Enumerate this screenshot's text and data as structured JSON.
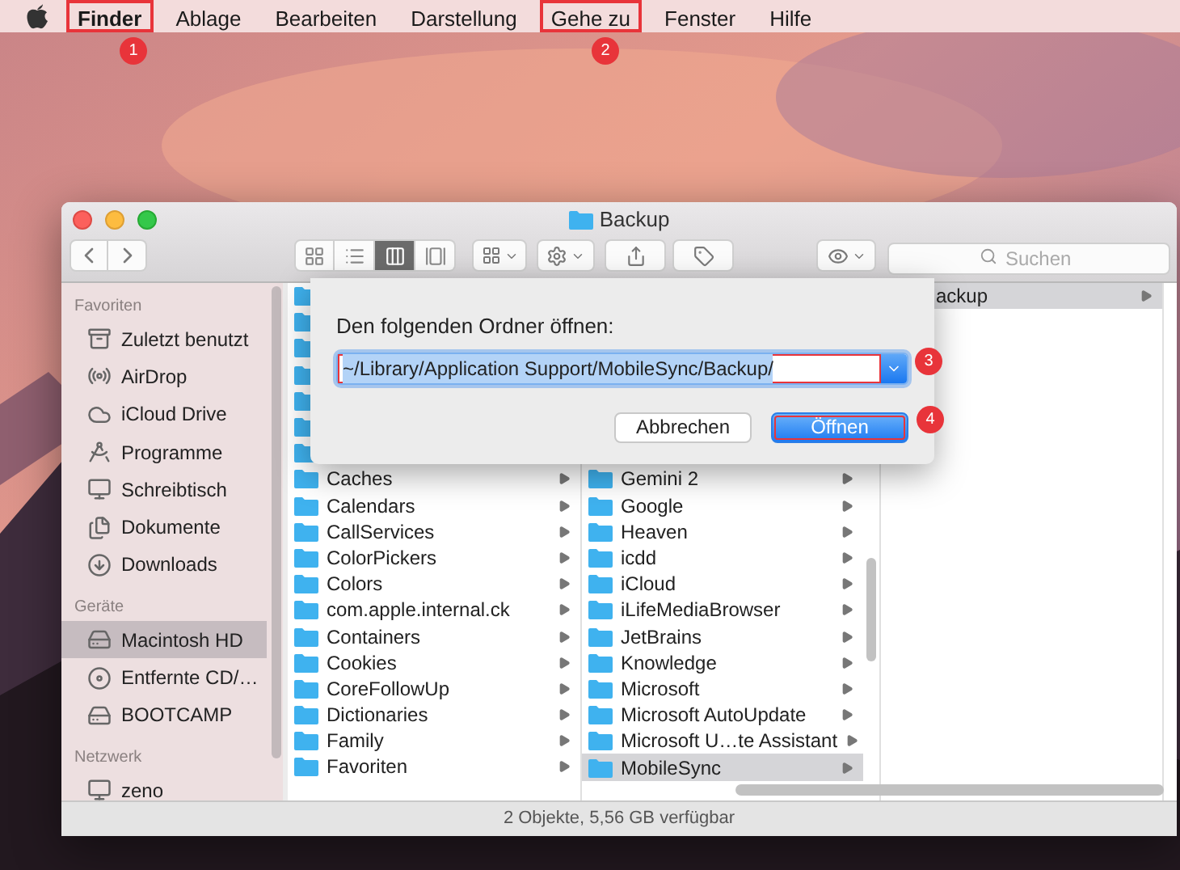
{
  "menu_bar": {
    "items": [
      {
        "label": "Finder",
        "bold": true,
        "highlighted": true
      },
      {
        "label": "Ablage",
        "bold": false,
        "highlighted": false
      },
      {
        "label": "Bearbeiten",
        "bold": false,
        "highlighted": false
      },
      {
        "label": "Darstellung",
        "bold": false,
        "highlighted": false
      },
      {
        "label": "Gehe zu",
        "bold": false,
        "highlighted": true
      },
      {
        "label": "Fenster",
        "bold": false,
        "highlighted": false
      },
      {
        "label": "Hilfe",
        "bold": false,
        "highlighted": false
      }
    ]
  },
  "annotations": [
    {
      "label": "1"
    },
    {
      "label": "2"
    },
    {
      "label": "3"
    },
    {
      "label": "4"
    }
  ],
  "window": {
    "title": "Backup",
    "view_modes": [
      {
        "selected": false
      },
      {
        "selected": false
      },
      {
        "selected": true
      },
      {
        "selected": false
      }
    ],
    "search": {
      "placeholder": "Suchen"
    },
    "sidebar": {
      "sections": [
        {
          "title": "Favoriten",
          "items": [
            {
              "label": "Zuletzt benutzt",
              "selected": false
            },
            {
              "label": "AirDrop",
              "selected": false
            },
            {
              "label": "iCloud Drive",
              "selected": false
            },
            {
              "label": "Programme",
              "selected": false
            },
            {
              "label": "Schreibtisch",
              "selected": false
            },
            {
              "label": "Dokumente",
              "selected": false
            },
            {
              "label": "Downloads",
              "selected": false
            }
          ]
        },
        {
          "title": "Geräte",
          "items": [
            {
              "label": "Macintosh HD",
              "selected": true
            },
            {
              "label": "Entfernte CD/…",
              "selected": false
            },
            {
              "label": "BOOTCAMP",
              "selected": false
            }
          ]
        },
        {
          "title": "Netzwerk",
          "items": [
            {
              "label": "zeno",
              "selected": false
            }
          ]
        }
      ]
    },
    "columns": [
      {
        "rows": [
          {
            "label": "Caches",
            "selected": false
          },
          {
            "label": "Calendars",
            "selected": false
          },
          {
            "label": "CallServices",
            "selected": false
          },
          {
            "label": "ColorPickers",
            "selected": false
          },
          {
            "label": "Colors",
            "selected": false
          },
          {
            "label": "com.apple.internal.ck",
            "selected": false
          },
          {
            "label": "Containers",
            "selected": false
          },
          {
            "label": "Cookies",
            "selected": false
          },
          {
            "label": "CoreFollowUp",
            "selected": false
          },
          {
            "label": "Dictionaries",
            "selected": false
          },
          {
            "label": "Family",
            "selected": false
          },
          {
            "label": "Favoriten",
            "selected": false
          }
        ]
      },
      {
        "rows": [
          {
            "label": "Gemini 2",
            "selected": false
          },
          {
            "label": "Google",
            "selected": false
          },
          {
            "label": "Heaven",
            "selected": false
          },
          {
            "label": "icdd",
            "selected": false
          },
          {
            "label": "iCloud",
            "selected": false
          },
          {
            "label": "iLifeMediaBrowser",
            "selected": false
          },
          {
            "label": "JetBrains",
            "selected": false
          },
          {
            "label": "Knowledge",
            "selected": false
          },
          {
            "label": "Microsoft",
            "selected": false
          },
          {
            "label": "Microsoft AutoUpdate",
            "selected": false
          },
          {
            "label": "Microsoft U…te Assistant",
            "selected": false
          },
          {
            "label": "MobileSync",
            "selected": true
          }
        ]
      },
      {
        "rows": [
          {
            "label": "ackup",
            "selected": true
          }
        ]
      }
    ],
    "status_bar": "2 Objekte, 5,56 GB verfügbar"
  },
  "dialog": {
    "prompt": "Den folgenden Ordner öffnen:",
    "path": {
      "value": "~/Library/Application Support/MobileSync/Backup/",
      "highlighted": true
    },
    "buttons": [
      {
        "label": "Abbrechen",
        "default": false,
        "highlighted": false
      },
      {
        "label": "Öffnen",
        "default": true,
        "highlighted": true
      }
    ]
  }
}
